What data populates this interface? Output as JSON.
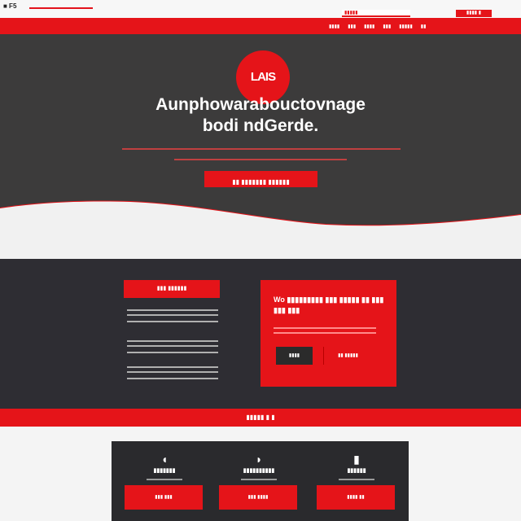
{
  "topbar": {
    "logo_text": "■ F5",
    "search_placeholder": "▮▮▮▮▮",
    "cart_label": "▮▮▮▮ ▮"
  },
  "nav": {
    "items": [
      "▮▮▮▮",
      "▮▮▮",
      "▮▮▮▮",
      "▮▮▮",
      "▮▮▮▮▮",
      "▮▮"
    ]
  },
  "hero": {
    "logo_text": "LAIS",
    "title_line1": "Aunphowarabouctovnage",
    "title_line2": "bodi ndGerde.",
    "cta_label": "▮▮ ▮▮▮▮▮▮▮ ▮▮▮▮▮▮"
  },
  "features": {
    "tag_label": "▮▮▮  ▮▮▮▮▮▮",
    "card_title": "Wo ▮▮▮▮▮▮▮▮▮ ▮▮▮ ▮▮▮▮▮ ▮▮ ▮▮▮ ▮▮▮ ▮▮▮",
    "card_dark_btn": "▮▮▮▮",
    "card_red_btn": "▮▮ ▮▮▮▮▮"
  },
  "band": {
    "label": "▮▮▮▮▮ ▮ ▮"
  },
  "bottom": {
    "columns": [
      {
        "icon": "leaf-icon",
        "glyph": "◖",
        "title": "▮▮▮▮▮▮▮",
        "button": "▮▮▮ ▮▮▮"
      },
      {
        "icon": "chat-icon",
        "glyph": "◗",
        "title": "▮▮▮▮▮▮▮▮▮▮",
        "button": "▮▮▮ ▮▮▮▮"
      },
      {
        "icon": "box-icon",
        "glyph": "▮",
        "title": "▮▮▮▮▮▮",
        "button": "▮▮▮▮ ▮▮"
      }
    ]
  },
  "colors": {
    "accent": "#e51419",
    "hero_bg": "#3c3b3b",
    "features_bg": "#2e2d33",
    "panel_bg": "#2a2a2d"
  }
}
